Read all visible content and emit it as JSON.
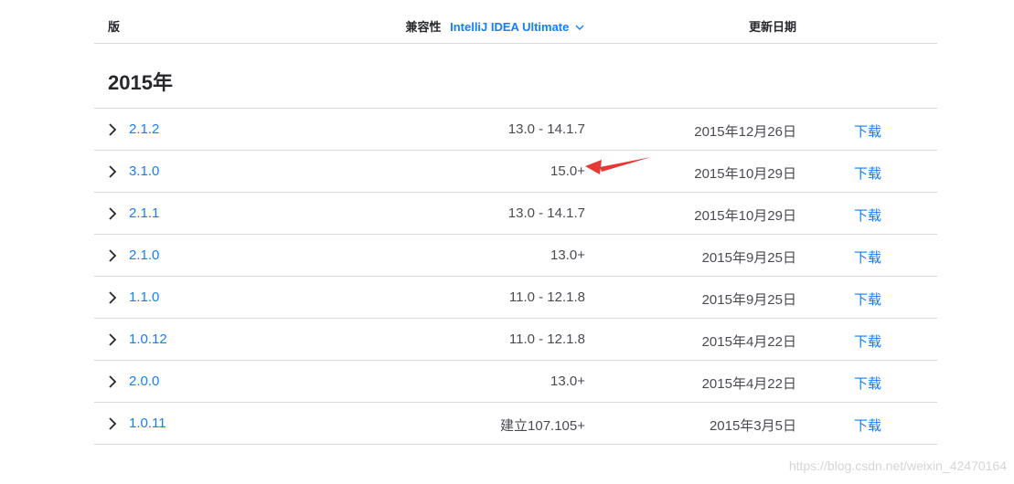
{
  "header": {
    "version_label": "版",
    "compat_label": "兼容性",
    "compat_selected": "IntelliJ IDEA Ultimate",
    "date_label": "更新日期"
  },
  "year_heading": "2015年",
  "rows": [
    {
      "version": "2.1.2",
      "compat": "13.0 - 14.1.7",
      "date": "2015年12月26日",
      "download": "下载"
    },
    {
      "version": "3.1.0",
      "compat": "15.0+",
      "date": "2015年10月29日",
      "download": "下载"
    },
    {
      "version": "2.1.1",
      "compat": "13.0 - 14.1.7",
      "date": "2015年10月29日",
      "download": "下载"
    },
    {
      "version": "2.1.0",
      "compat": "13.0+",
      "date": "2015年9月25日",
      "download": "下载"
    },
    {
      "version": "1.1.0",
      "compat": "11.0 - 12.1.8",
      "date": "2015年9月25日",
      "download": "下载"
    },
    {
      "version": "1.0.12",
      "compat": "11.0 - 12.1.8",
      "date": "2015年4月22日",
      "download": "下载"
    },
    {
      "version": "2.0.0",
      "compat": "13.0+",
      "date": "2015年4月22日",
      "download": "下载"
    },
    {
      "version": "1.0.11",
      "compat": "建立107.105+",
      "date": "2015年3月5日",
      "download": "下载"
    }
  ],
  "watermark": "https://blog.csdn.net/weixin_42470164",
  "colors": {
    "link": "#167dff",
    "annotation_arrow": "#e53935"
  }
}
